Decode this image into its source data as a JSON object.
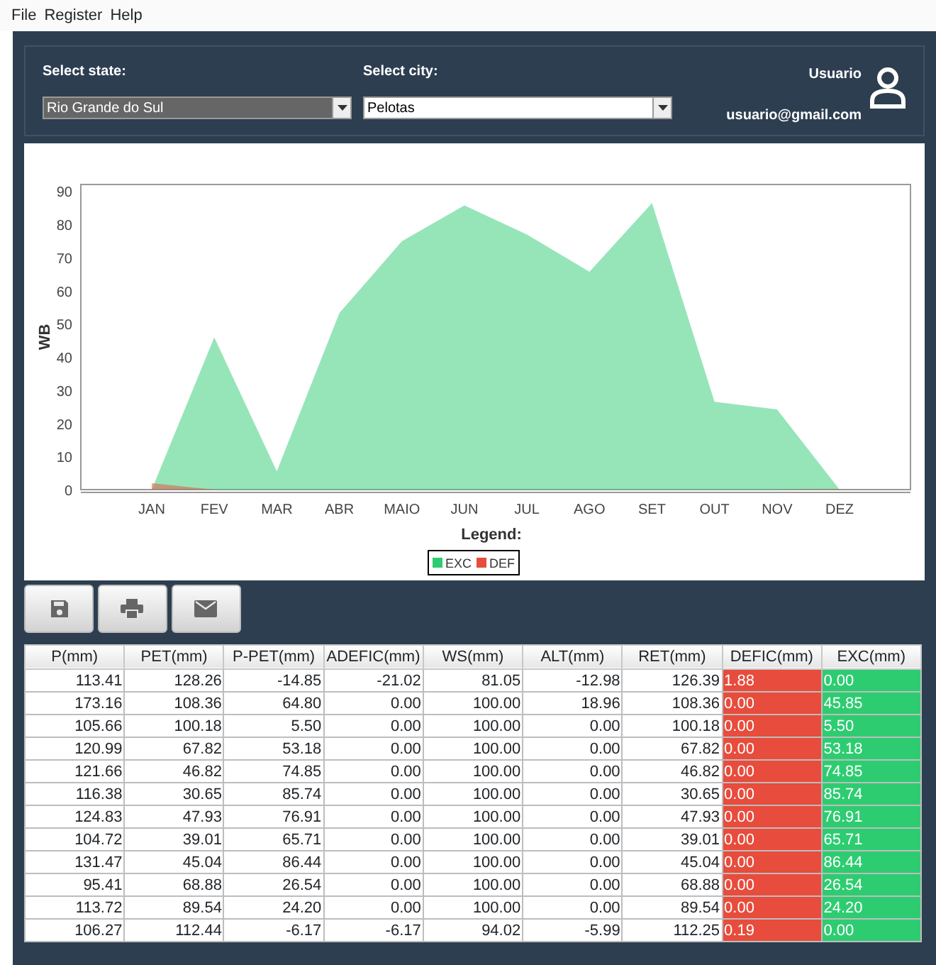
{
  "menu": [
    "File",
    "Register",
    "Help"
  ],
  "filters": [
    {
      "label": "Select state:",
      "value": "Rio Grande do Sul",
      "focused": true
    },
    {
      "label": "Select city:",
      "value": "Pelotas",
      "focused": false
    }
  ],
  "user": {
    "name": "Usuario",
    "email": "usuario@gmail.com"
  },
  "chart": {
    "chart_data": {
      "type": "area",
      "xlabel": "Legend:",
      "ylabel": "WB",
      "categories": [
        "JAN",
        "FEV",
        "MAR",
        "ABR",
        "MAIO",
        "JUN",
        "JUL",
        "AGO",
        "SET",
        "OUT",
        "NOV",
        "DEZ"
      ],
      "series": [
        {
          "name": "EXC",
          "color": "#2ecc71",
          "values": [
            0,
            45.9,
            5.5,
            53.2,
            74.9,
            85.7,
            76.9,
            65.7,
            86.4,
            26.5,
            24.2,
            0
          ]
        },
        {
          "name": "DEF",
          "color": "#e74c3c",
          "values": [
            1.9,
            0,
            0,
            0,
            0,
            0,
            0,
            0,
            0,
            0,
            0,
            0.2
          ]
        }
      ],
      "legend": "bottom",
      "ylim": [
        0,
        92
      ],
      "yticks": [
        0,
        10,
        20,
        30,
        40,
        50,
        60,
        70,
        80,
        90
      ]
    }
  },
  "toolbar": [
    {
      "kind": "save"
    },
    {
      "kind": "print"
    },
    {
      "kind": "mail"
    }
  ],
  "table": {
    "columns": [
      {
        "label": "P(mm)"
      },
      {
        "label": "PET(mm)"
      },
      {
        "label": "P-PET(mm)"
      },
      {
        "label": "ADEFIC(mm)"
      },
      {
        "label": "WS(mm)"
      },
      {
        "label": "ALT(mm)"
      },
      {
        "label": "RET(mm)"
      },
      {
        "label": "DEFIC(mm)",
        "color": "#e74c3c"
      },
      {
        "label": "EXC(mm)",
        "color": "#2ecc71"
      }
    ],
    "rows": [
      [
        "113.41",
        "128.26",
        "-14.85",
        "-21.02",
        "81.05",
        "-12.98",
        "126.39",
        "1.88",
        "0.00"
      ],
      [
        "173.16",
        "108.36",
        "64.80",
        "0.00",
        "100.00",
        "18.96",
        "108.36",
        "0.00",
        "45.85"
      ],
      [
        "105.66",
        "100.18",
        "5.50",
        "0.00",
        "100.00",
        "0.00",
        "100.18",
        "0.00",
        "5.50"
      ],
      [
        "120.99",
        "67.82",
        "53.18",
        "0.00",
        "100.00",
        "0.00",
        "67.82",
        "0.00",
        "53.18"
      ],
      [
        "121.66",
        "46.82",
        "74.85",
        "0.00",
        "100.00",
        "0.00",
        "46.82",
        "0.00",
        "74.85"
      ],
      [
        "116.38",
        "30.65",
        "85.74",
        "0.00",
        "100.00",
        "0.00",
        "30.65",
        "0.00",
        "85.74"
      ],
      [
        "124.83",
        "47.93",
        "76.91",
        "0.00",
        "100.00",
        "0.00",
        "47.93",
        "0.00",
        "76.91"
      ],
      [
        "104.72",
        "39.01",
        "65.71",
        "0.00",
        "100.00",
        "0.00",
        "39.01",
        "0.00",
        "65.71"
      ],
      [
        "131.47",
        "45.04",
        "86.44",
        "0.00",
        "100.00",
        "0.00",
        "45.04",
        "0.00",
        "86.44"
      ],
      [
        "95.41",
        "68.88",
        "26.54",
        "0.00",
        "100.00",
        "0.00",
        "68.88",
        "0.00",
        "26.54"
      ],
      [
        "113.72",
        "89.54",
        "24.20",
        "0.00",
        "100.00",
        "0.00",
        "89.54",
        "0.00",
        "24.20"
      ],
      [
        "106.27",
        "112.44",
        "-6.17",
        "-6.17",
        "94.02",
        "-5.99",
        "112.25",
        "0.19",
        "0.00"
      ]
    ]
  }
}
